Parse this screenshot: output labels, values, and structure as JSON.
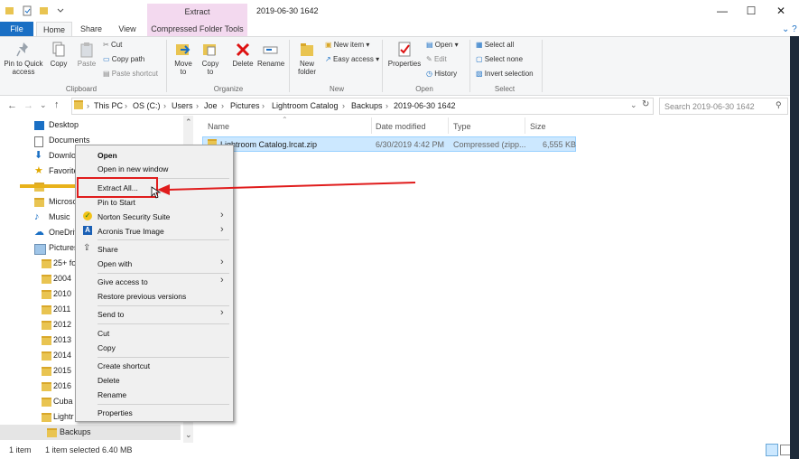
{
  "title_bar": {
    "context_tab_label": "Extract",
    "window_title": "2019-06-30 1642",
    "minimize": "—",
    "maximize": "☐",
    "close": "✕"
  },
  "tabs": {
    "file": "File",
    "home": "Home",
    "share": "Share",
    "view": "View",
    "compressed": "Compressed Folder Tools"
  },
  "ribbon": {
    "clipboard": {
      "group": "Clipboard",
      "pin": "Pin to Quick access",
      "copy": "Copy",
      "paste": "Paste",
      "cut": "Cut",
      "copy_path": "Copy path",
      "paste_shortcut": "Paste shortcut"
    },
    "organize": {
      "group": "Organize",
      "move_to": "Move to",
      "copy_to": "Copy to",
      "delete": "Delete",
      "rename": "Rename"
    },
    "new": {
      "group": "New",
      "new_folder": "New folder",
      "new_item": "New item",
      "easy_access": "Easy access"
    },
    "open": {
      "group": "Open",
      "properties": "Properties",
      "open": "Open",
      "edit": "Edit",
      "history": "History"
    },
    "select": {
      "group": "Select",
      "select_all": "Select all",
      "select_none": "Select none",
      "invert": "Invert selection"
    }
  },
  "address": {
    "crumbs": [
      "This PC",
      "OS (C:)",
      "Users",
      "Joe",
      "Pictures",
      "Lightroom Catalog",
      "Backups",
      "2019-06-30 1642"
    ],
    "search_placeholder": "Search 2019-06-30 1642"
  },
  "nav": [
    {
      "label": "Desktop",
      "icon": "desktop-icon"
    },
    {
      "label": "Documents",
      "icon": "documents-icon"
    },
    {
      "label": "Downlo",
      "icon": "downloads-icon"
    },
    {
      "label": "Favorite",
      "icon": "star-icon"
    },
    {
      "label": "",
      "icon": "folder-icon"
    },
    {
      "label": "Microsc",
      "icon": "folder-icon"
    },
    {
      "label": "Music",
      "icon": "music-icon"
    },
    {
      "label": "OneDriv",
      "icon": "onedrive-icon"
    },
    {
      "label": "Pictures",
      "icon": "pictures-icon"
    },
    {
      "label": "25+ fo",
      "icon": "folder-icon"
    },
    {
      "label": "2004",
      "icon": "folder-icon"
    },
    {
      "label": "2010",
      "icon": "folder-icon"
    },
    {
      "label": "2011",
      "icon": "folder-icon"
    },
    {
      "label": "2012",
      "icon": "folder-icon"
    },
    {
      "label": "2013",
      "icon": "folder-icon"
    },
    {
      "label": "2014",
      "icon": "folder-icon"
    },
    {
      "label": "2015",
      "icon": "folder-icon"
    },
    {
      "label": "2016",
      "icon": "folder-icon"
    },
    {
      "label": "Cuba",
      "icon": "folder-icon"
    },
    {
      "label": "Lightr",
      "icon": "folder-icon"
    },
    {
      "label": "Backups",
      "icon": "folder-icon"
    }
  ],
  "columns": {
    "name": "Name",
    "date": "Date modified",
    "type": "Type",
    "size": "Size"
  },
  "file": {
    "name": "Lightroom Catalog.lrcat.zip",
    "date": "6/30/2019 4:42 PM",
    "type": "Compressed (zipp...",
    "size": "6,555 KB"
  },
  "status": {
    "items": "1 item",
    "selected": "1 item selected  6.40 MB"
  },
  "context_menu": {
    "open": "Open",
    "open_new_window": "Open in new window",
    "extract_all": "Extract All...",
    "pin_to_start": "Pin to Start",
    "norton": "Norton Security Suite",
    "acronis": "Acronis True Image",
    "share": "Share",
    "open_with": "Open with",
    "give_access": "Give access to",
    "restore": "Restore previous versions",
    "send_to": "Send to",
    "cut": "Cut",
    "copy": "Copy",
    "create_shortcut": "Create shortcut",
    "delete": "Delete",
    "rename": "Rename",
    "properties": "Properties"
  },
  "colors": {
    "file_tab": "#1a6fc4",
    "context_tab": "#f3d9ef",
    "highlight_red": "#e01c1c",
    "selection": "#cce8ff"
  }
}
